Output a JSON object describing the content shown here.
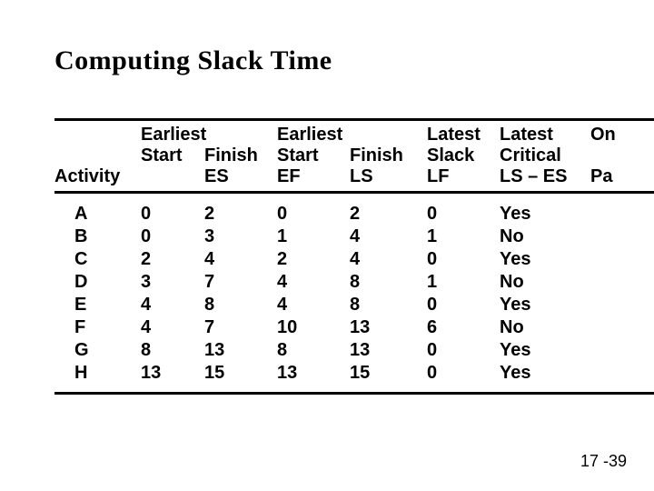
{
  "title": "Computing Slack Time",
  "footer": "17 -39",
  "header": {
    "line1": {
      "c1": "",
      "c2": "Earliest",
      "c3": "",
      "c4": "Earliest",
      "c5": "",
      "c6": "Latest",
      "c7": "Latest",
      "c8": "On"
    },
    "line2": {
      "c1": "",
      "c2": "Start",
      "c3": "Finish",
      "c4": "Start",
      "c5": "Finish",
      "c6": "Slack",
      "c7": "Critical",
      "c8": ""
    },
    "line3": {
      "c1": "Activity",
      "c2": "",
      "c3": "ES",
      "c4": "EF",
      "c5": "LS",
      "c6": "LF",
      "c7": "LS – ES",
      "c8": "Pa"
    }
  },
  "chart_data": {
    "type": "table",
    "title": "Computing Slack Time",
    "columns": [
      "Activity",
      "Earliest Start (ES)",
      "Earliest Finish (EF)",
      "Latest Start (LS)",
      "Latest Finish (LF)",
      "Slack (LS – ES)",
      "On Critical Path"
    ],
    "rows": [
      {
        "activity": "A",
        "es": 0,
        "ef": 2,
        "ls": 0,
        "lf": 2,
        "slack": 0,
        "critical": "Yes"
      },
      {
        "activity": "B",
        "es": 0,
        "ef": 3,
        "ls": 1,
        "lf": 4,
        "slack": 1,
        "critical": "No"
      },
      {
        "activity": "C",
        "es": 2,
        "ef": 4,
        "ls": 2,
        "lf": 4,
        "slack": 0,
        "critical": "Yes"
      },
      {
        "activity": "D",
        "es": 3,
        "ef": 7,
        "ls": 4,
        "lf": 8,
        "slack": 1,
        "critical": "No"
      },
      {
        "activity": "E",
        "es": 4,
        "ef": 8,
        "ls": 4,
        "lf": 8,
        "slack": 0,
        "critical": "Yes"
      },
      {
        "activity": "F",
        "es": 4,
        "ef": 7,
        "ls": 10,
        "lf": 13,
        "slack": 6,
        "critical": "No"
      },
      {
        "activity": "G",
        "es": 8,
        "ef": 13,
        "ls": 8,
        "lf": 13,
        "slack": 0,
        "critical": "Yes"
      },
      {
        "activity": "H",
        "es": 13,
        "ef": 15,
        "ls": 13,
        "lf": 15,
        "slack": 0,
        "critical": "Yes"
      }
    ]
  }
}
